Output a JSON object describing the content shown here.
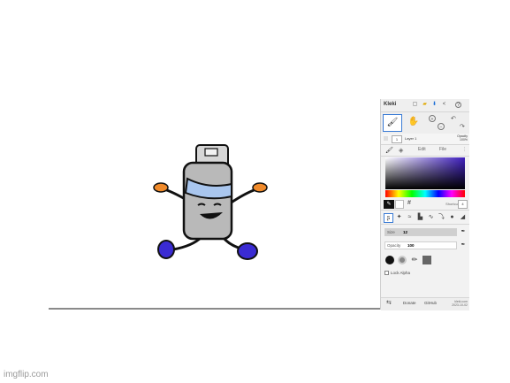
{
  "watermark": "imgflip.com",
  "app": {
    "name": "Kleki"
  },
  "layer": {
    "number": "1",
    "name": "Layer 1",
    "opacity_label": "Opacity",
    "opacity_value": "100%"
  },
  "tabs": {
    "edit": "Edit",
    "file": "File"
  },
  "color": {
    "hash": "#",
    "shortcut_label": "Shortcut",
    "shortcut_value": "4",
    "current": "#000000"
  },
  "brush": {
    "size_label": "Size",
    "size_value": "12",
    "opacity_label": "Opacity",
    "opacity_value": "100",
    "lock_alpha": "Lock Alpha"
  },
  "footer": {
    "donate": "Donate",
    "github": "GitHub",
    "version_line1": "kleki.com",
    "version_line2": "2023-10-02"
  },
  "drawing": {
    "body_color": "#b9b9b9",
    "band_color": "#a9c6ee",
    "hand_color": "#f08a2a",
    "foot_color": "#3a2bd3"
  },
  "icons": [
    "brush-icon",
    "hand-icon",
    "zoom-in-icon",
    "zoom-out-icon",
    "undo-icon",
    "redo-icon",
    "new-file-icon",
    "open-folder-icon",
    "download-icon",
    "share-icon",
    "help-icon",
    "eyedropper-icon",
    "layers-icon",
    "swap-icon"
  ]
}
